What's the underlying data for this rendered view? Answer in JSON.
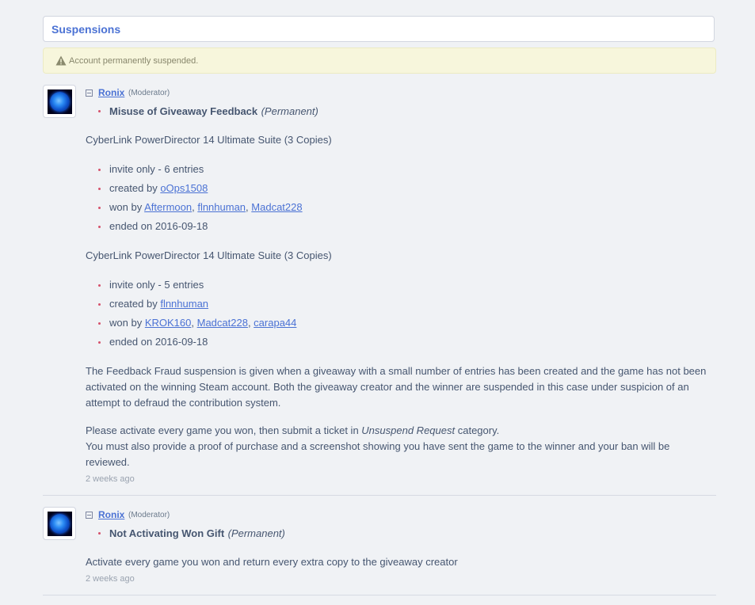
{
  "header": {
    "title": "Suspensions"
  },
  "notice": {
    "text": "Account permanently suspended."
  },
  "entries": [
    {
      "user": "Ronix",
      "role": "(Moderator)",
      "reason": "Misuse of Giveaway Feedback",
      "duration": "(Permanent)",
      "giveaways": [
        {
          "title": "CyberLink PowerDirector 14 Ultimate Suite (3 Copies)",
          "entries_text": "invite only - 6 entries",
          "created_prefix": "created by",
          "creator": "oOps1508",
          "won_prefix": "won by",
          "winners": [
            "Aftermoon",
            "flnnhuman",
            "Madcat228"
          ],
          "ended": "ended on 2016-09-18"
        },
        {
          "title": "CyberLink PowerDirector 14 Ultimate Suite (3 Copies)",
          "entries_text": "invite only - 5 entries",
          "created_prefix": "created by",
          "creator": "flnnhuman",
          "won_prefix": "won by",
          "winners": [
            "KROK160",
            "Madcat228",
            "carapa44"
          ],
          "ended": "ended on 2016-09-18"
        }
      ],
      "explanation": "The Feedback Fraud suspension is given when a giveaway with a small number of entries has been created and the game has not been activated on the winning Steam account. Both the giveaway creator and the winner are suspended in this case under suspicion of an attempt to defraud the contribution system.",
      "instruction_pre": "Please activate every game you won, then submit a ticket in ",
      "instruction_em": "Unsuspend Request",
      "instruction_post": " category.",
      "instruction_2": "You must also provide a proof of purchase and a screenshot showing you have sent the game to the winner and your ban will be reviewed.",
      "time": "2 weeks ago"
    },
    {
      "user": "Ronix",
      "role": "(Moderator)",
      "reason": "Not Activating Won Gift",
      "duration": "(Permanent)",
      "explanation": "Activate every game you won and return every extra copy to the giveaway creator",
      "time": "2 weeks ago"
    }
  ],
  "colors": {
    "accent": "#4b72d4",
    "bullet": "#d5526c",
    "notice_bg": "#f7f6dc"
  },
  "separator": ", "
}
